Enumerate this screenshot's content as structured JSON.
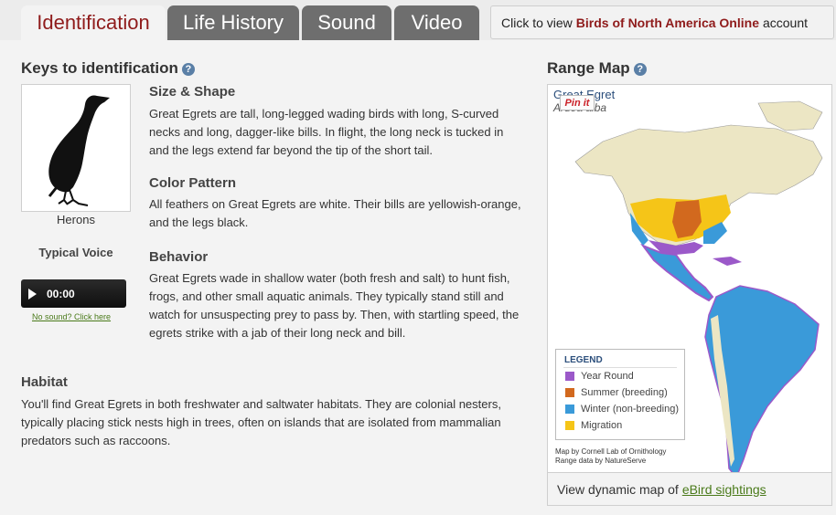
{
  "tabs": [
    {
      "label": "Identification",
      "active": true
    },
    {
      "label": "Life History",
      "active": false
    },
    {
      "label": "Sound",
      "active": false
    },
    {
      "label": "Video",
      "active": false
    }
  ],
  "bna": {
    "prefix": "Click to view",
    "link": "Birds of North America Online",
    "suffix": "account"
  },
  "keys": {
    "title": "Keys to identification",
    "bird_group": "Herons",
    "voice_title": "Typical Voice",
    "player_time": "00:00",
    "no_sound": "No sound? Click here"
  },
  "sections": [
    {
      "title": "Size & Shape",
      "text": "Great Egrets are tall, long-legged wading birds with long, S-curved necks and long, dagger-like bills. In flight, the long neck is tucked in and the legs extend far beyond the tip of the short tail."
    },
    {
      "title": "Color Pattern",
      "text": "All feathers on Great Egrets are white. Their bills are yellowish-orange, and the legs black."
    },
    {
      "title": "Behavior",
      "text": "Great Egrets wade in shallow water (both fresh and salt) to hunt fish, frogs, and other small aquatic animals. They typically stand still and watch for unsuspecting prey to pass by. Then, with startling speed, the egrets strike with a jab of their long neck and bill."
    }
  ],
  "habitat": {
    "title": "Habitat",
    "text": "You'll find Great Egrets in both freshwater and saltwater habitats. They are colonial nesters, typically placing stick nests high in trees, often on islands that are isolated from mammalian predators such as raccoons."
  },
  "range": {
    "title": "Range Map",
    "species": "Great Egret",
    "scientific": "Ardea alba",
    "pin_label": "Pin it",
    "legend_title": "LEGEND",
    "legend": [
      {
        "label": "Year Round",
        "color": "#9b59c9"
      },
      {
        "label": "Summer (breeding)",
        "color": "#d2691e"
      },
      {
        "label": "Winter (non-breeding)",
        "color": "#3a9ad9"
      },
      {
        "label": "Migration",
        "color": "#f5c518"
      }
    ],
    "credit_line1": "Map by Cornell Lab of Ornithology",
    "credit_line2": "Range data by NatureServe"
  },
  "ebird": {
    "prefix": "View dynamic map of",
    "link": "eBird sightings"
  },
  "colors": {
    "active_tab_text": "#8f1b1b",
    "inactive_tab_bg": "#6e6e6e",
    "link_green": "#4a7a1a",
    "land": "#ece6c4"
  }
}
